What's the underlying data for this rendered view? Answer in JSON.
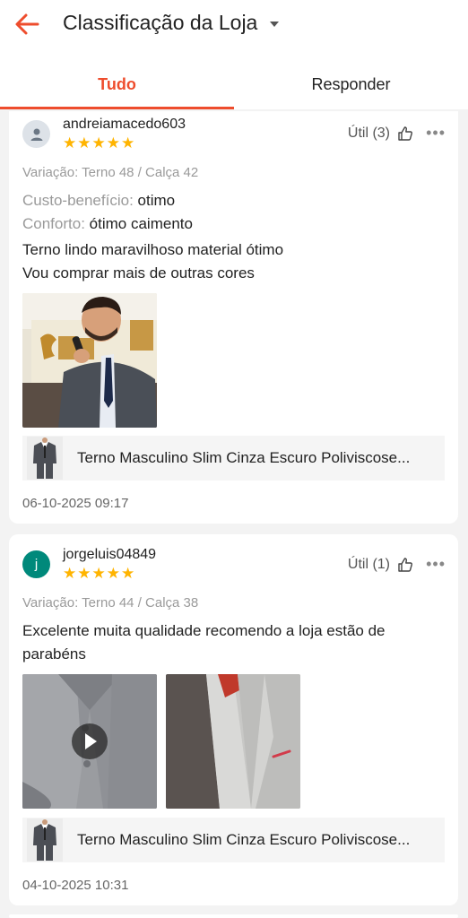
{
  "header": {
    "title": "Classificação da Loja",
    "tabs": [
      {
        "label": "Tudo",
        "active": true
      },
      {
        "label": "Responder",
        "active": false
      }
    ]
  },
  "reviews": [
    {
      "username": "andreiamacedo603",
      "avatar_icon": "user-icon",
      "stars": "★★★★★",
      "rating": 5,
      "useful": "Útil (3)",
      "variation": "Variação: Terno 48 / Calça 42",
      "attrs": [
        {
          "key": "Custo-benefício:",
          "value": "otimo"
        },
        {
          "key": "Conforto:",
          "value": "ótimo caimento"
        }
      ],
      "text_lines": [
        "Terno lindo maravilhoso material ótimo",
        "Vou comprar mais de outras cores"
      ],
      "product": "Terno Masculino Slim Cinza Escuro Poliviscose...",
      "date": "06-10-2025 09:17"
    },
    {
      "username": "jorgeluis04849",
      "avatar_letter": "j",
      "stars": "★★★★★",
      "rating": 5,
      "useful": "Útil (1)",
      "variation": "Variação: Terno 44 / Calça 38",
      "text_lines": [
        "Excelente muita qualidade recomendo a loja estão de",
        "parabéns"
      ],
      "product": "Terno Masculino Slim Cinza Escuro Poliviscose...",
      "date": "04-10-2025 10:31"
    }
  ],
  "colors": {
    "accent": "#ee4d2d",
    "star": "#ffb400",
    "teal_avatar": "#00897b"
  }
}
